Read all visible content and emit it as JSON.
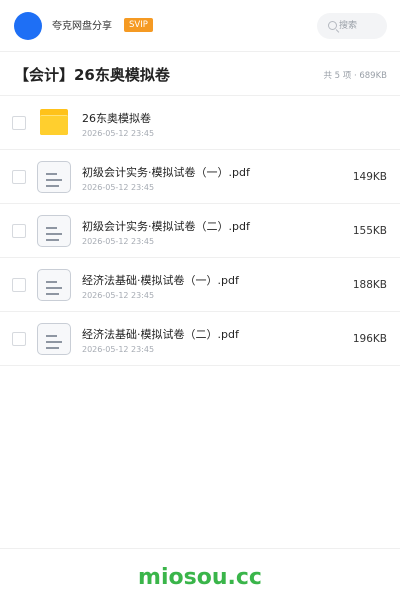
{
  "header": {
    "brand": "夸克网盘分享",
    "badge": "SVIP",
    "search_placeholder": "搜索"
  },
  "folder": {
    "title": "【会计】26东奥模拟卷",
    "meta": "共 5 项 · 689KB"
  },
  "items": [
    {
      "type": "folder",
      "icon": "folder-icon",
      "name": "26东奥模拟卷",
      "date": "2026-05-12 23:45",
      "size": ""
    },
    {
      "type": "pdf",
      "icon": "document-icon",
      "name": "初级会计实务·模拟试卷（一）.pdf",
      "date": "2026-05-12 23:45",
      "size": "149KB"
    },
    {
      "type": "pdf",
      "icon": "document-icon",
      "name": "初级会计实务·模拟试卷（二）.pdf",
      "date": "2026-05-12 23:45",
      "size": "155KB"
    },
    {
      "type": "pdf",
      "icon": "document-icon",
      "name": "经济法基础·模拟试卷（一）.pdf",
      "date": "2026-05-12 23:45",
      "size": "188KB"
    },
    {
      "type": "pdf",
      "icon": "document-icon",
      "name": "经济法基础·模拟试卷（二）.pdf",
      "date": "2026-05-12 23:45",
      "size": "196KB"
    }
  ],
  "footer": {
    "watermark": "miosou.cc"
  },
  "colors": {
    "accent": "#1e6ff5",
    "badge": "#f59a23",
    "folder": "#ffc21a",
    "watermark": "#3ab54a"
  }
}
